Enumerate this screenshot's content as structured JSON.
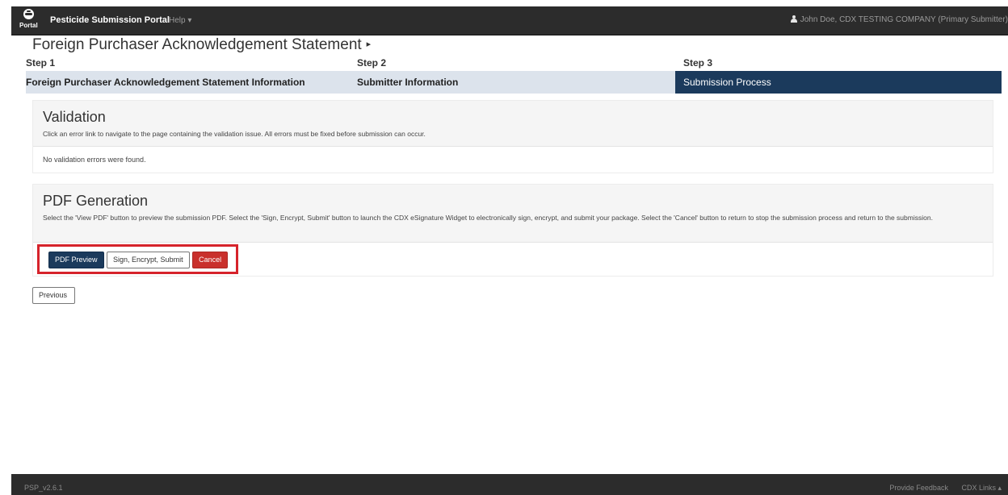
{
  "navbar": {
    "brand_word": "Portal",
    "app_title": "Pesticide Submission Portal",
    "help_label": "Help ▾",
    "user_text": "John Doe, CDX TESTING COMPANY (Primary Submitter)"
  },
  "page": {
    "title": "Foreign Purchaser Acknowledgement Statement",
    "title_arrow": "▸"
  },
  "steps": {
    "labels": [
      "Step 1",
      "Step 2",
      "Step 3"
    ],
    "names": [
      "Foreign Purchaser Acknowledgement Statement Information",
      "Submitter Information",
      "Submission Process"
    ],
    "active_index": 2
  },
  "validation": {
    "heading": "Validation",
    "description": "Click an error link to navigate to the page containing the validation issue. All errors must be fixed before submission can occur.",
    "result": "No validation errors were found."
  },
  "pdf": {
    "heading": "PDF Generation",
    "description": "Select the 'View PDF' button to preview the submission PDF. Select the 'Sign, Encrypt, Submit' button to launch the CDX eSignature Widget to electronically sign, encrypt, and submit your package. Select the 'Cancel' button to return to stop the submission process and return to the submission.",
    "buttons": {
      "preview": "PDF Preview",
      "sign": "Sign, Encrypt, Submit",
      "cancel": "Cancel"
    }
  },
  "previous_label": "Previous",
  "footer": {
    "version": "PSP_v2.6.1",
    "feedback": "Provide Feedback",
    "cdx_links": "CDX Links ▴"
  },
  "colors": {
    "navbar": "#2c2c2c",
    "primary": "#1b3a5c",
    "danger": "#c9302c",
    "highlight": "#d6232b",
    "steps_bar": "#dce3ec"
  }
}
